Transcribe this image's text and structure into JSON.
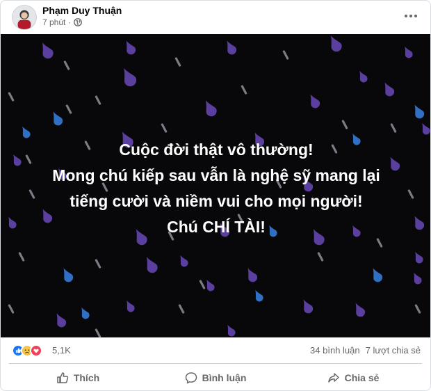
{
  "post": {
    "author": "Phạm Duy Thuận",
    "time": "7 phút",
    "separator": "·",
    "privacy_icon": "globe-icon",
    "image_text": [
      "Cuộc đời thật vô thường!",
      "Mong chú kiếp sau vẫn là nghệ sỹ mang lại",
      "tiếng cười và niềm vui cho mọi người!",
      "Chú CHÍ TÀI!"
    ],
    "image_background": "#08080a",
    "drop_colors": [
      "#5a3f9e",
      "#2f6fc4",
      "#7a7d86"
    ]
  },
  "reactions": {
    "icons": [
      "like-icon",
      "sad-icon",
      "love-icon"
    ],
    "count": "5,1K",
    "comments": "34 bình luận",
    "shares": "7 lượt chia sẻ"
  },
  "actions": {
    "like": "Thích",
    "comment": "Bình luận",
    "share": "Chia sẻ"
  }
}
